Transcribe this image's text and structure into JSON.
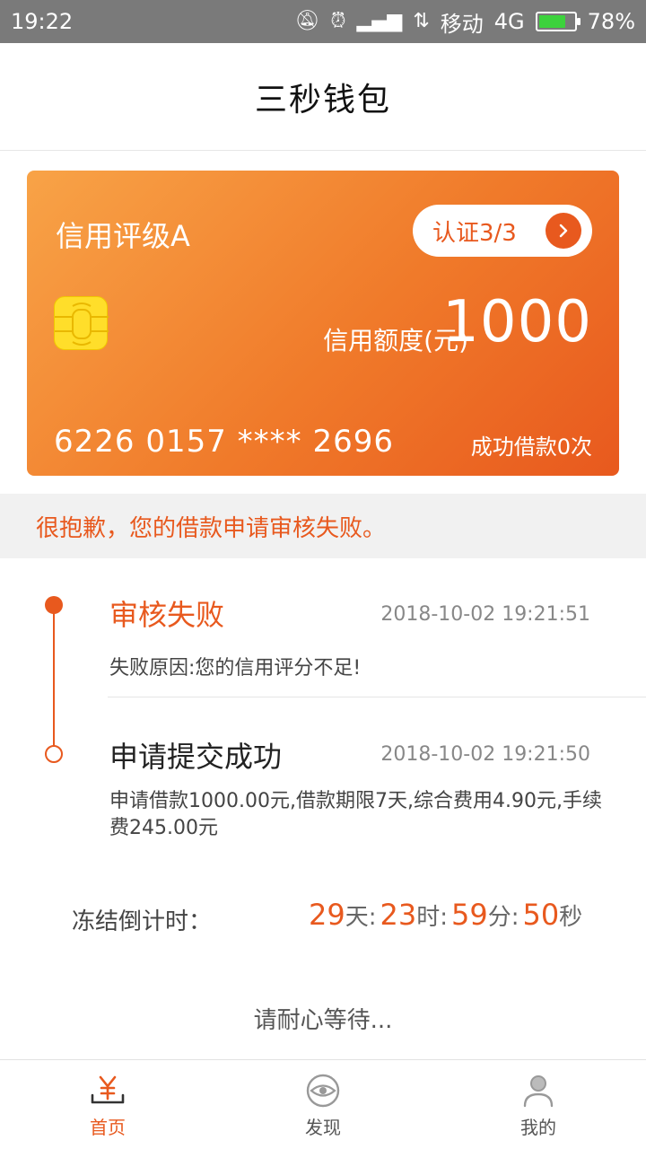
{
  "statusbar": {
    "time": "19:22",
    "carrier": "移动",
    "network": "4G",
    "battery": "78%",
    "battery_level": 0.78
  },
  "header": {
    "title": "三秒钱包"
  },
  "card": {
    "rating": "信用评级A",
    "verify_label": "认证3/3",
    "limit_label": "信用额度(元)",
    "limit_value": "1000",
    "card_number": "6226 0157 **** 2696",
    "loan_count": "成功借款0次"
  },
  "alert": {
    "message": "很抱歉，您的借款申请审核失败。"
  },
  "timeline": {
    "items": [
      {
        "title": "审核失败",
        "time": "2018-10-02 19:21:51",
        "desc": "失败原因:您的信用评分不足!"
      },
      {
        "title": "申请提交成功",
        "time": "2018-10-02 19:21:50",
        "desc": "申请借款1000.00元,借款期限7天,综合费用4.90元,手续费245.00元"
      }
    ]
  },
  "countdown": {
    "label": "冻结倒计时：",
    "days": "29",
    "days_unit": "天:",
    "hours": "23",
    "hours_unit": "时:",
    "minutes": "59",
    "minutes_unit": "分:",
    "seconds": "50",
    "seconds_unit": "秒"
  },
  "wait_text": "请耐心等待...",
  "bottomnav": {
    "items": [
      {
        "label": "首页",
        "icon": "yen-home-icon"
      },
      {
        "label": "发现",
        "icon": "eye-discover-icon"
      },
      {
        "label": "我的",
        "icon": "user-profile-icon"
      }
    ]
  },
  "colors": {
    "accent": "#e8591e",
    "card_start": "#f8a347",
    "card_end": "#e8591e",
    "chip": "#ffde2a"
  }
}
